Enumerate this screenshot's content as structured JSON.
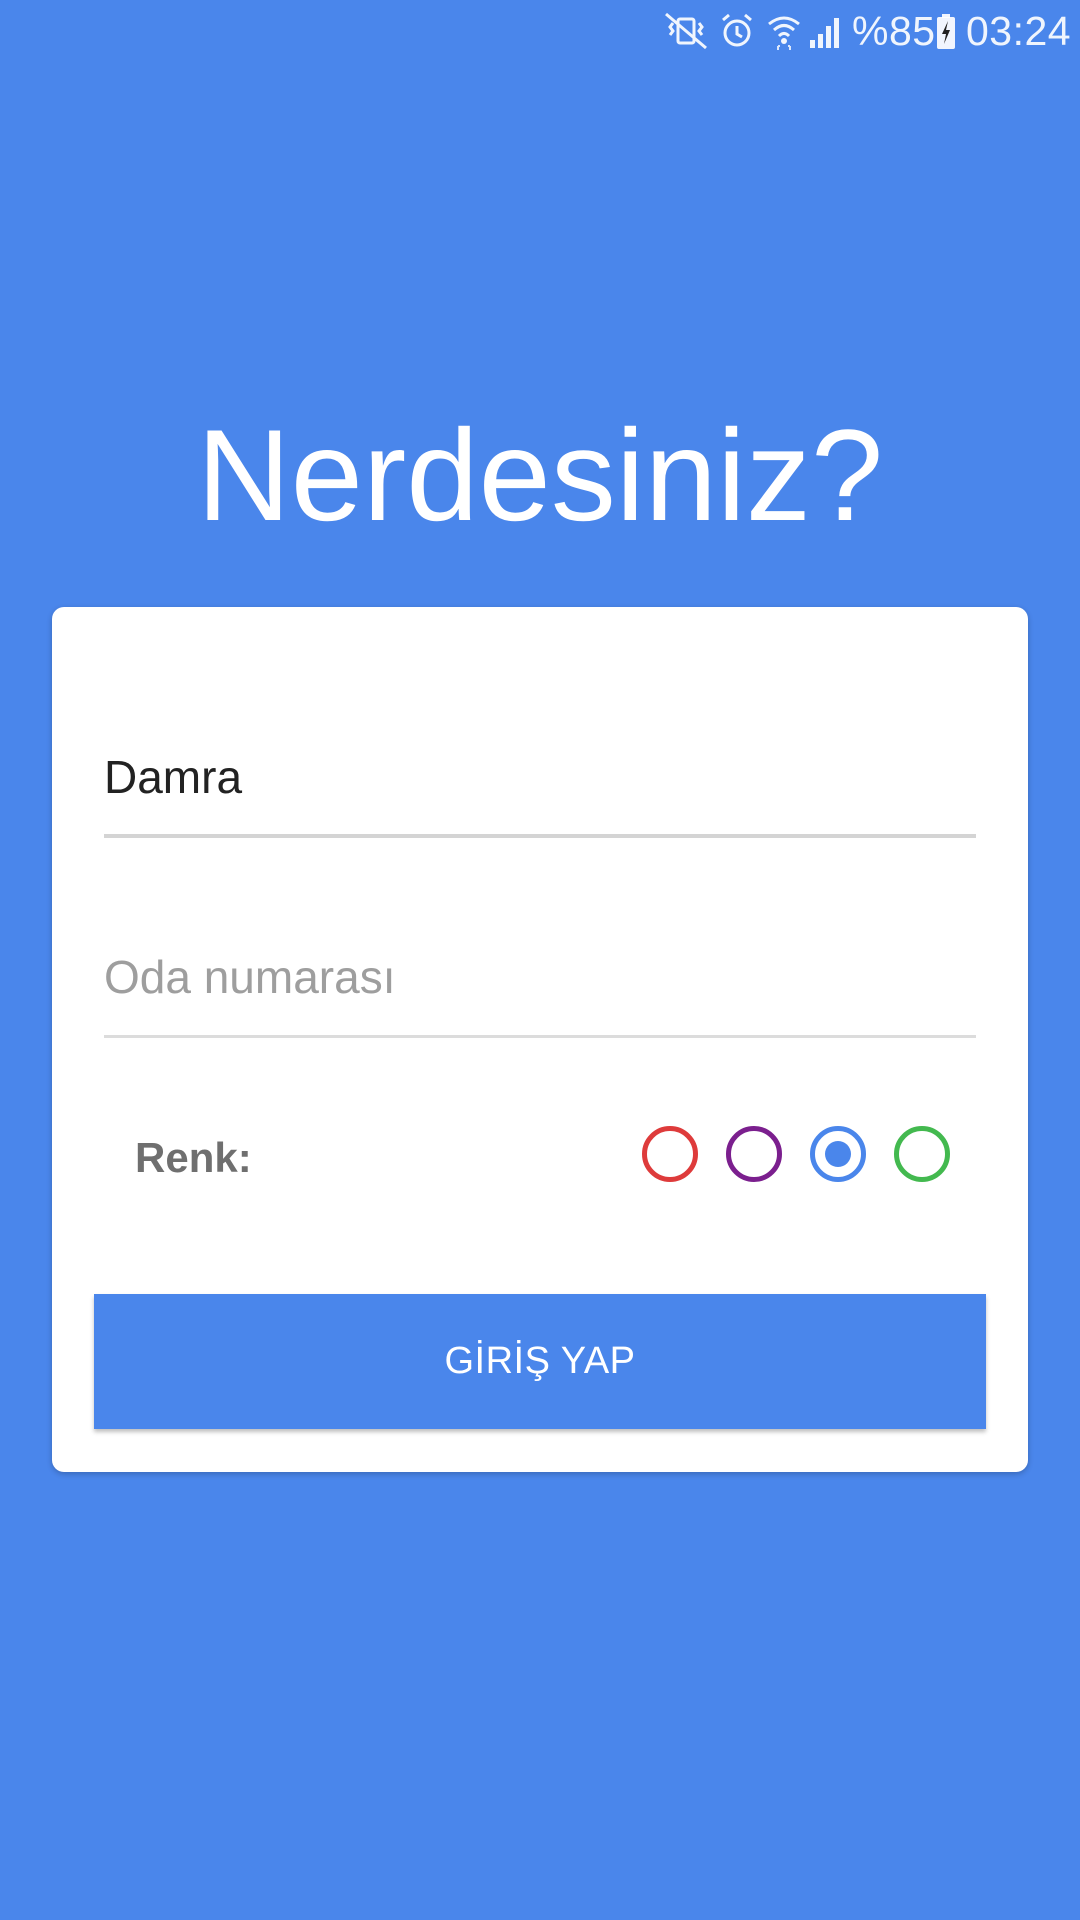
{
  "status_bar": {
    "icons": [
      "vibrate-mute-icon",
      "alarm-icon",
      "wifi-icon",
      "signal-icon",
      "battery-charging-icon"
    ],
    "battery_percent": "%85",
    "time": "03:24"
  },
  "title": "Nerdesiniz?",
  "form": {
    "name_field": {
      "value": "Damra",
      "placeholder": ""
    },
    "room_field": {
      "value": "",
      "placeholder": "Oda numarası"
    },
    "color_label": "Renk:",
    "color_options": [
      {
        "name": "red",
        "color": "#DE3B3B",
        "selected": false
      },
      {
        "name": "purple",
        "color": "#7B1F8E",
        "selected": false
      },
      {
        "name": "blue",
        "color": "#4A86EB",
        "selected": true
      },
      {
        "name": "green",
        "color": "#43B94F",
        "selected": false
      }
    ],
    "submit_label": "GİRİŞ YAP"
  },
  "colors": {
    "background": "#4A86EB",
    "card": "#FFFFFF",
    "button": "#4A86EB"
  }
}
